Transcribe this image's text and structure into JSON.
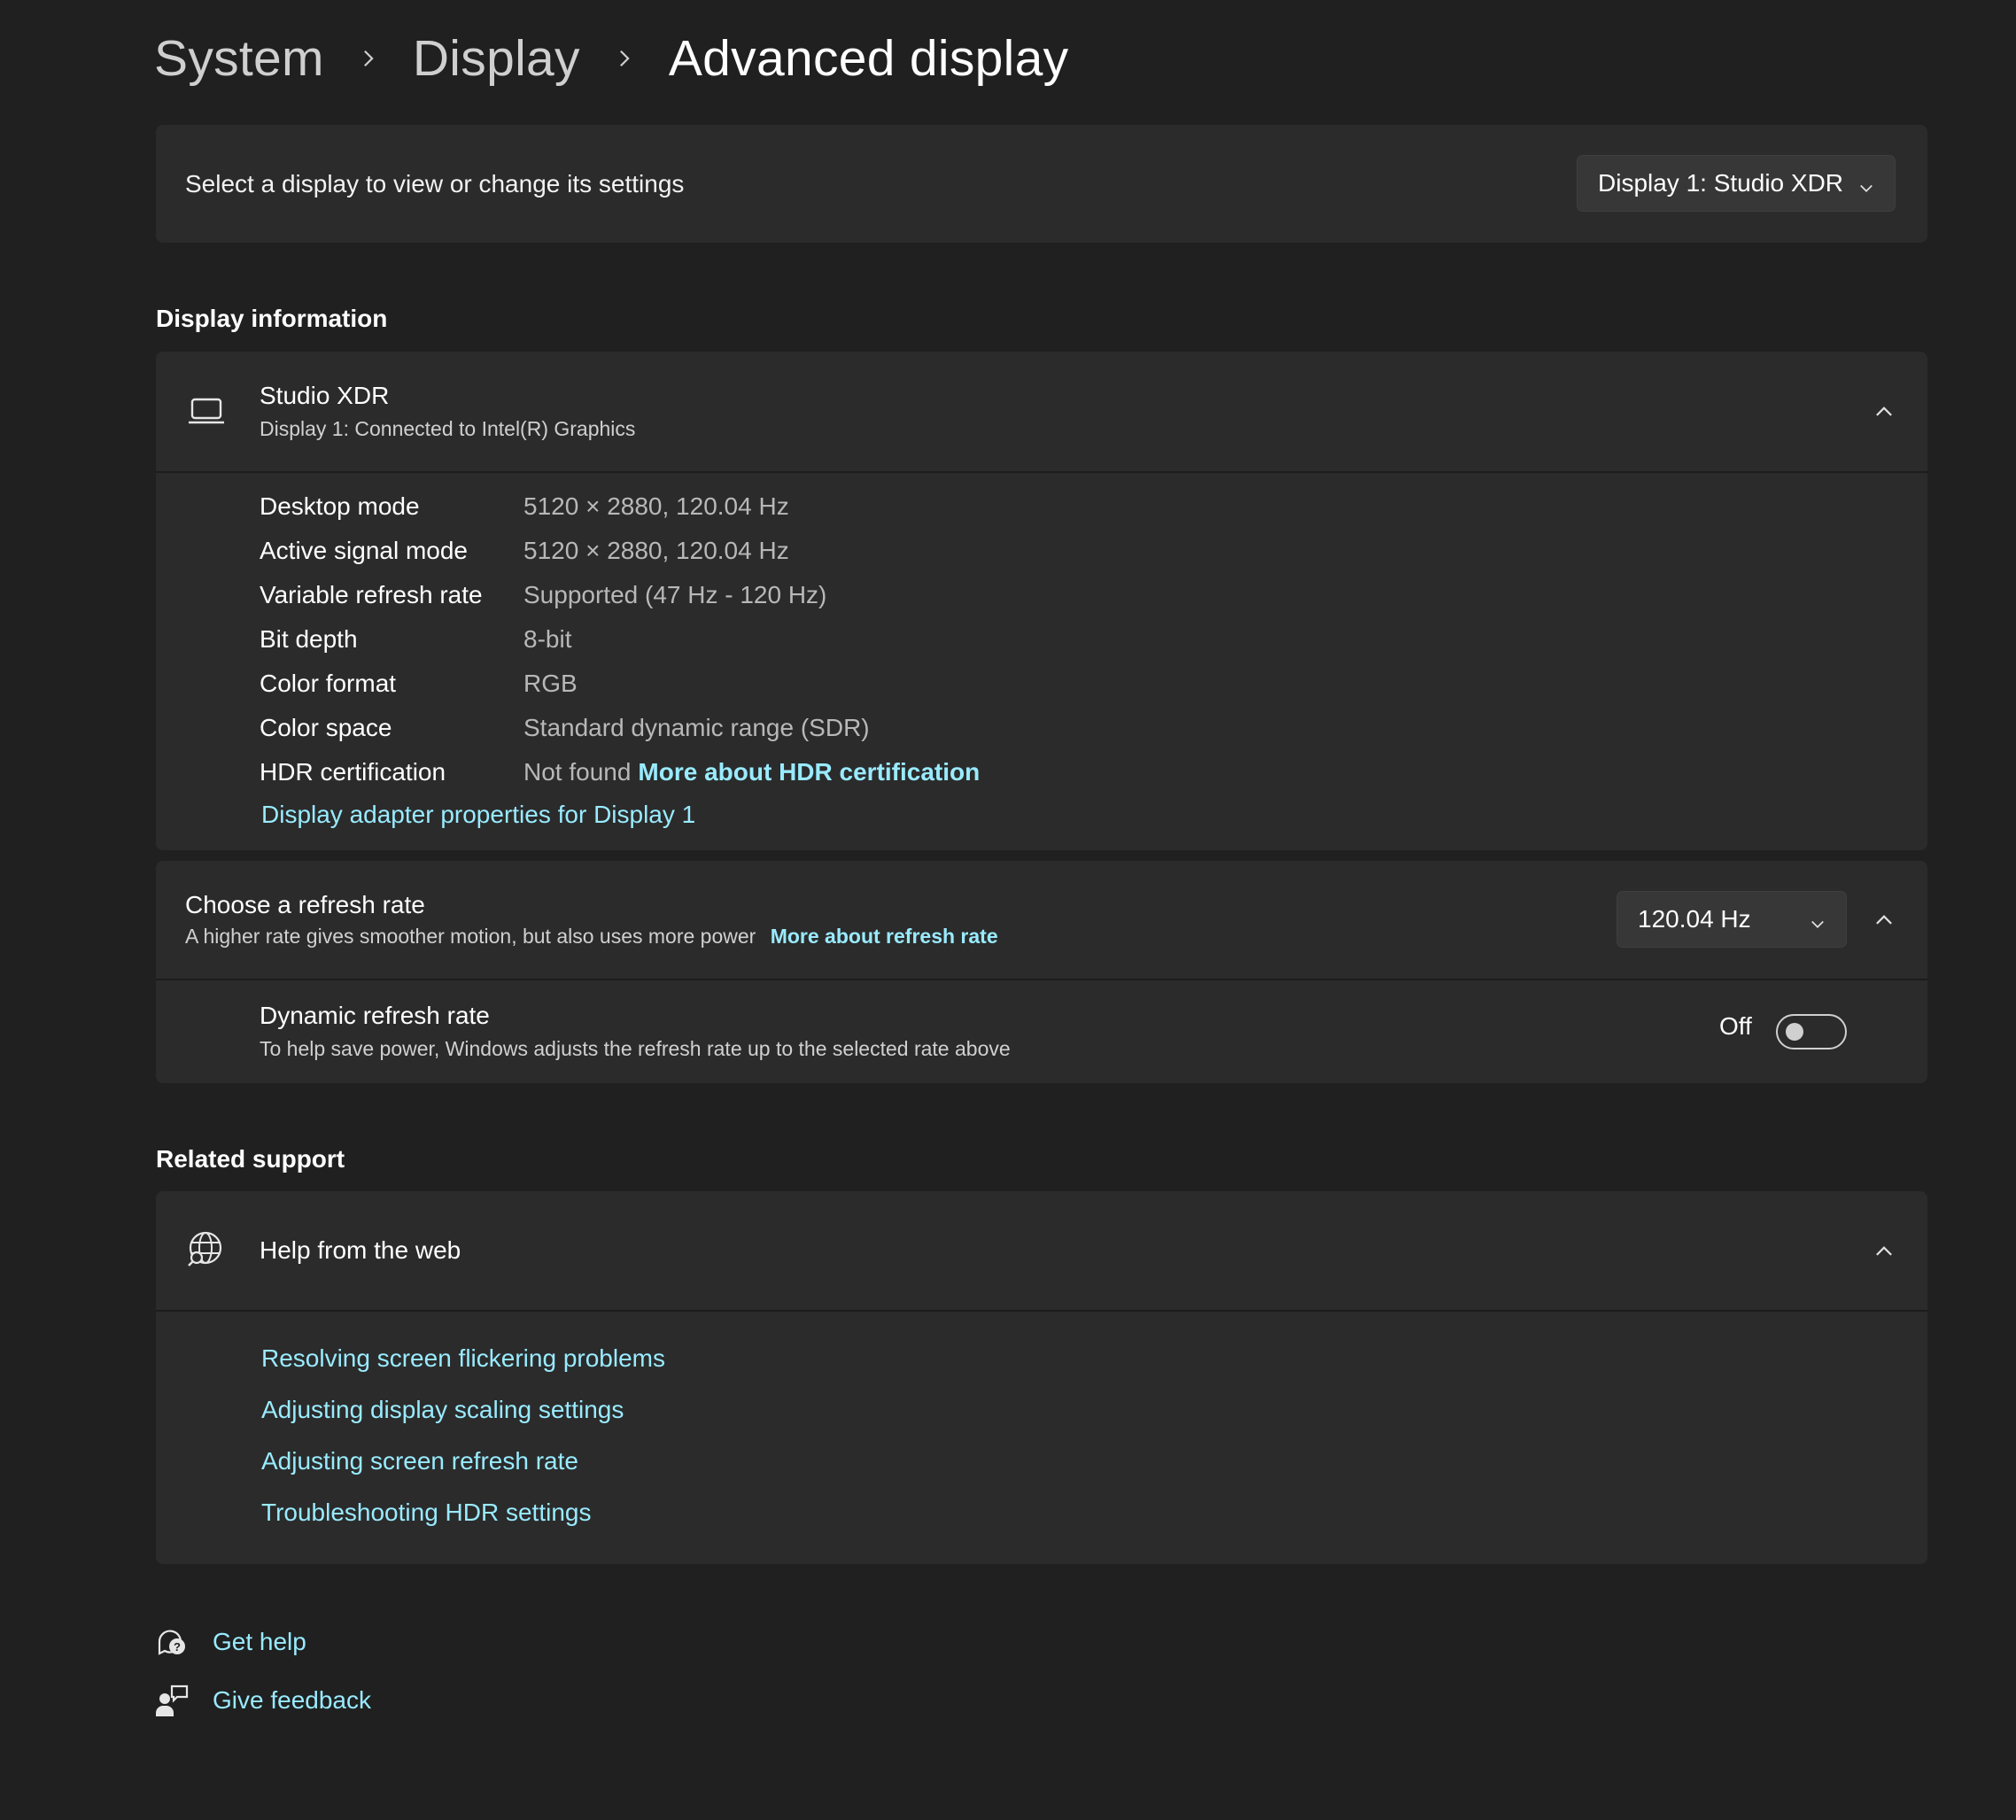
{
  "breadcrumb": {
    "items": [
      "System",
      "Display"
    ],
    "current": "Advanced display"
  },
  "display_select": {
    "label": "Select a display to view or change its settings",
    "selected": "Display 1: Studio XDR"
  },
  "display_information": {
    "section_title": "Display information",
    "monitor_name": "Studio XDR",
    "monitor_subtitle": "Display 1: Connected to Intel(R) Graphics",
    "rows": [
      {
        "label": "Desktop mode",
        "value": "5120 × 2880, 120.04 Hz"
      },
      {
        "label": "Active signal mode",
        "value": "5120 × 2880, 120.04 Hz"
      },
      {
        "label": "Variable refresh rate",
        "value": "Supported (47 Hz - 120 Hz)"
      },
      {
        "label": "Bit depth",
        "value": "8-bit"
      },
      {
        "label": "Color format",
        "value": "RGB"
      },
      {
        "label": "Color space",
        "value": "Standard dynamic range (SDR)"
      },
      {
        "label": "HDR certification",
        "value": "Not found",
        "link": "More about HDR certification"
      }
    ],
    "adapter_link": "Display adapter properties for Display 1"
  },
  "refresh_rate": {
    "title": "Choose a refresh rate",
    "subtitle": "A higher rate gives smoother motion, but also uses more power",
    "link": "More about refresh rate",
    "selected": "120.04 Hz"
  },
  "dynamic_refresh": {
    "title": "Dynamic refresh rate",
    "subtitle": "To help save power, Windows adjusts the refresh rate up to the selected rate above",
    "state": "Off"
  },
  "related_support": {
    "section_title": "Related support",
    "help_title": "Help from the web",
    "links": [
      "Resolving screen flickering problems",
      "Adjusting display scaling settings",
      "Adjusting screen refresh rate",
      "Troubleshooting HDR settings"
    ]
  },
  "footer": {
    "get_help": "Get help",
    "give_feedback": "Give feedback"
  },
  "icons": {
    "breadcrumb_separator": "chevron-right-icon",
    "dropdown": "chevron-down-icon",
    "collapse": "chevron-up-icon",
    "monitor": "monitor-icon",
    "globe": "globe-search-icon",
    "get_help": "help-chat-icon",
    "feedback": "feedback-icon"
  },
  "colors": {
    "background": "#202020",
    "card": "#2b2b2b",
    "accent_link": "#99ebff"
  }
}
